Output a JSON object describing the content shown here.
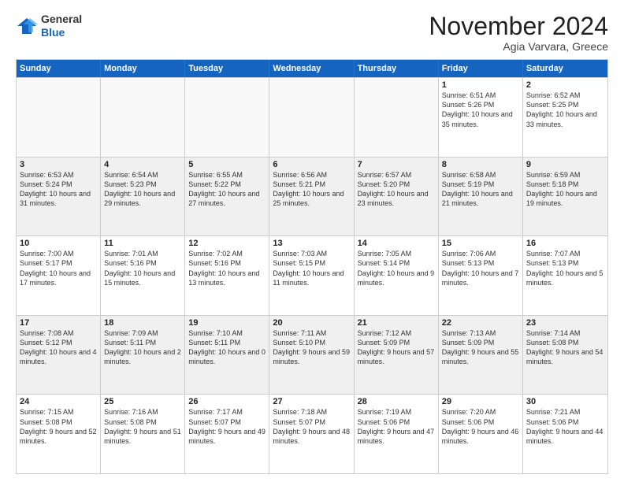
{
  "logo": {
    "general": "General",
    "blue": "Blue"
  },
  "header": {
    "month": "November 2024",
    "location": "Agia Varvara, Greece"
  },
  "days": [
    "Sunday",
    "Monday",
    "Tuesday",
    "Wednesday",
    "Thursday",
    "Friday",
    "Saturday"
  ],
  "weeks": [
    [
      {
        "day": "",
        "info": ""
      },
      {
        "day": "",
        "info": ""
      },
      {
        "day": "",
        "info": ""
      },
      {
        "day": "",
        "info": ""
      },
      {
        "day": "",
        "info": ""
      },
      {
        "day": "1",
        "info": "Sunrise: 6:51 AM\nSunset: 5:26 PM\nDaylight: 10 hours and 35 minutes."
      },
      {
        "day": "2",
        "info": "Sunrise: 6:52 AM\nSunset: 5:25 PM\nDaylight: 10 hours and 33 minutes."
      }
    ],
    [
      {
        "day": "3",
        "info": "Sunrise: 6:53 AM\nSunset: 5:24 PM\nDaylight: 10 hours and 31 minutes."
      },
      {
        "day": "4",
        "info": "Sunrise: 6:54 AM\nSunset: 5:23 PM\nDaylight: 10 hours and 29 minutes."
      },
      {
        "day": "5",
        "info": "Sunrise: 6:55 AM\nSunset: 5:22 PM\nDaylight: 10 hours and 27 minutes."
      },
      {
        "day": "6",
        "info": "Sunrise: 6:56 AM\nSunset: 5:21 PM\nDaylight: 10 hours and 25 minutes."
      },
      {
        "day": "7",
        "info": "Sunrise: 6:57 AM\nSunset: 5:20 PM\nDaylight: 10 hours and 23 minutes."
      },
      {
        "day": "8",
        "info": "Sunrise: 6:58 AM\nSunset: 5:19 PM\nDaylight: 10 hours and 21 minutes."
      },
      {
        "day": "9",
        "info": "Sunrise: 6:59 AM\nSunset: 5:18 PM\nDaylight: 10 hours and 19 minutes."
      }
    ],
    [
      {
        "day": "10",
        "info": "Sunrise: 7:00 AM\nSunset: 5:17 PM\nDaylight: 10 hours and 17 minutes."
      },
      {
        "day": "11",
        "info": "Sunrise: 7:01 AM\nSunset: 5:16 PM\nDaylight: 10 hours and 15 minutes."
      },
      {
        "day": "12",
        "info": "Sunrise: 7:02 AM\nSunset: 5:16 PM\nDaylight: 10 hours and 13 minutes."
      },
      {
        "day": "13",
        "info": "Sunrise: 7:03 AM\nSunset: 5:15 PM\nDaylight: 10 hours and 11 minutes."
      },
      {
        "day": "14",
        "info": "Sunrise: 7:05 AM\nSunset: 5:14 PM\nDaylight: 10 hours and 9 minutes."
      },
      {
        "day": "15",
        "info": "Sunrise: 7:06 AM\nSunset: 5:13 PM\nDaylight: 10 hours and 7 minutes."
      },
      {
        "day": "16",
        "info": "Sunrise: 7:07 AM\nSunset: 5:13 PM\nDaylight: 10 hours and 5 minutes."
      }
    ],
    [
      {
        "day": "17",
        "info": "Sunrise: 7:08 AM\nSunset: 5:12 PM\nDaylight: 10 hours and 4 minutes."
      },
      {
        "day": "18",
        "info": "Sunrise: 7:09 AM\nSunset: 5:11 PM\nDaylight: 10 hours and 2 minutes."
      },
      {
        "day": "19",
        "info": "Sunrise: 7:10 AM\nSunset: 5:11 PM\nDaylight: 10 hours and 0 minutes."
      },
      {
        "day": "20",
        "info": "Sunrise: 7:11 AM\nSunset: 5:10 PM\nDaylight: 9 hours and 59 minutes."
      },
      {
        "day": "21",
        "info": "Sunrise: 7:12 AM\nSunset: 5:09 PM\nDaylight: 9 hours and 57 minutes."
      },
      {
        "day": "22",
        "info": "Sunrise: 7:13 AM\nSunset: 5:09 PM\nDaylight: 9 hours and 55 minutes."
      },
      {
        "day": "23",
        "info": "Sunrise: 7:14 AM\nSunset: 5:08 PM\nDaylight: 9 hours and 54 minutes."
      }
    ],
    [
      {
        "day": "24",
        "info": "Sunrise: 7:15 AM\nSunset: 5:08 PM\nDaylight: 9 hours and 52 minutes."
      },
      {
        "day": "25",
        "info": "Sunrise: 7:16 AM\nSunset: 5:08 PM\nDaylight: 9 hours and 51 minutes."
      },
      {
        "day": "26",
        "info": "Sunrise: 7:17 AM\nSunset: 5:07 PM\nDaylight: 9 hours and 49 minutes."
      },
      {
        "day": "27",
        "info": "Sunrise: 7:18 AM\nSunset: 5:07 PM\nDaylight: 9 hours and 48 minutes."
      },
      {
        "day": "28",
        "info": "Sunrise: 7:19 AM\nSunset: 5:06 PM\nDaylight: 9 hours and 47 minutes."
      },
      {
        "day": "29",
        "info": "Sunrise: 7:20 AM\nSunset: 5:06 PM\nDaylight: 9 hours and 46 minutes."
      },
      {
        "day": "30",
        "info": "Sunrise: 7:21 AM\nSunset: 5:06 PM\nDaylight: 9 hours and 44 minutes."
      }
    ]
  ]
}
